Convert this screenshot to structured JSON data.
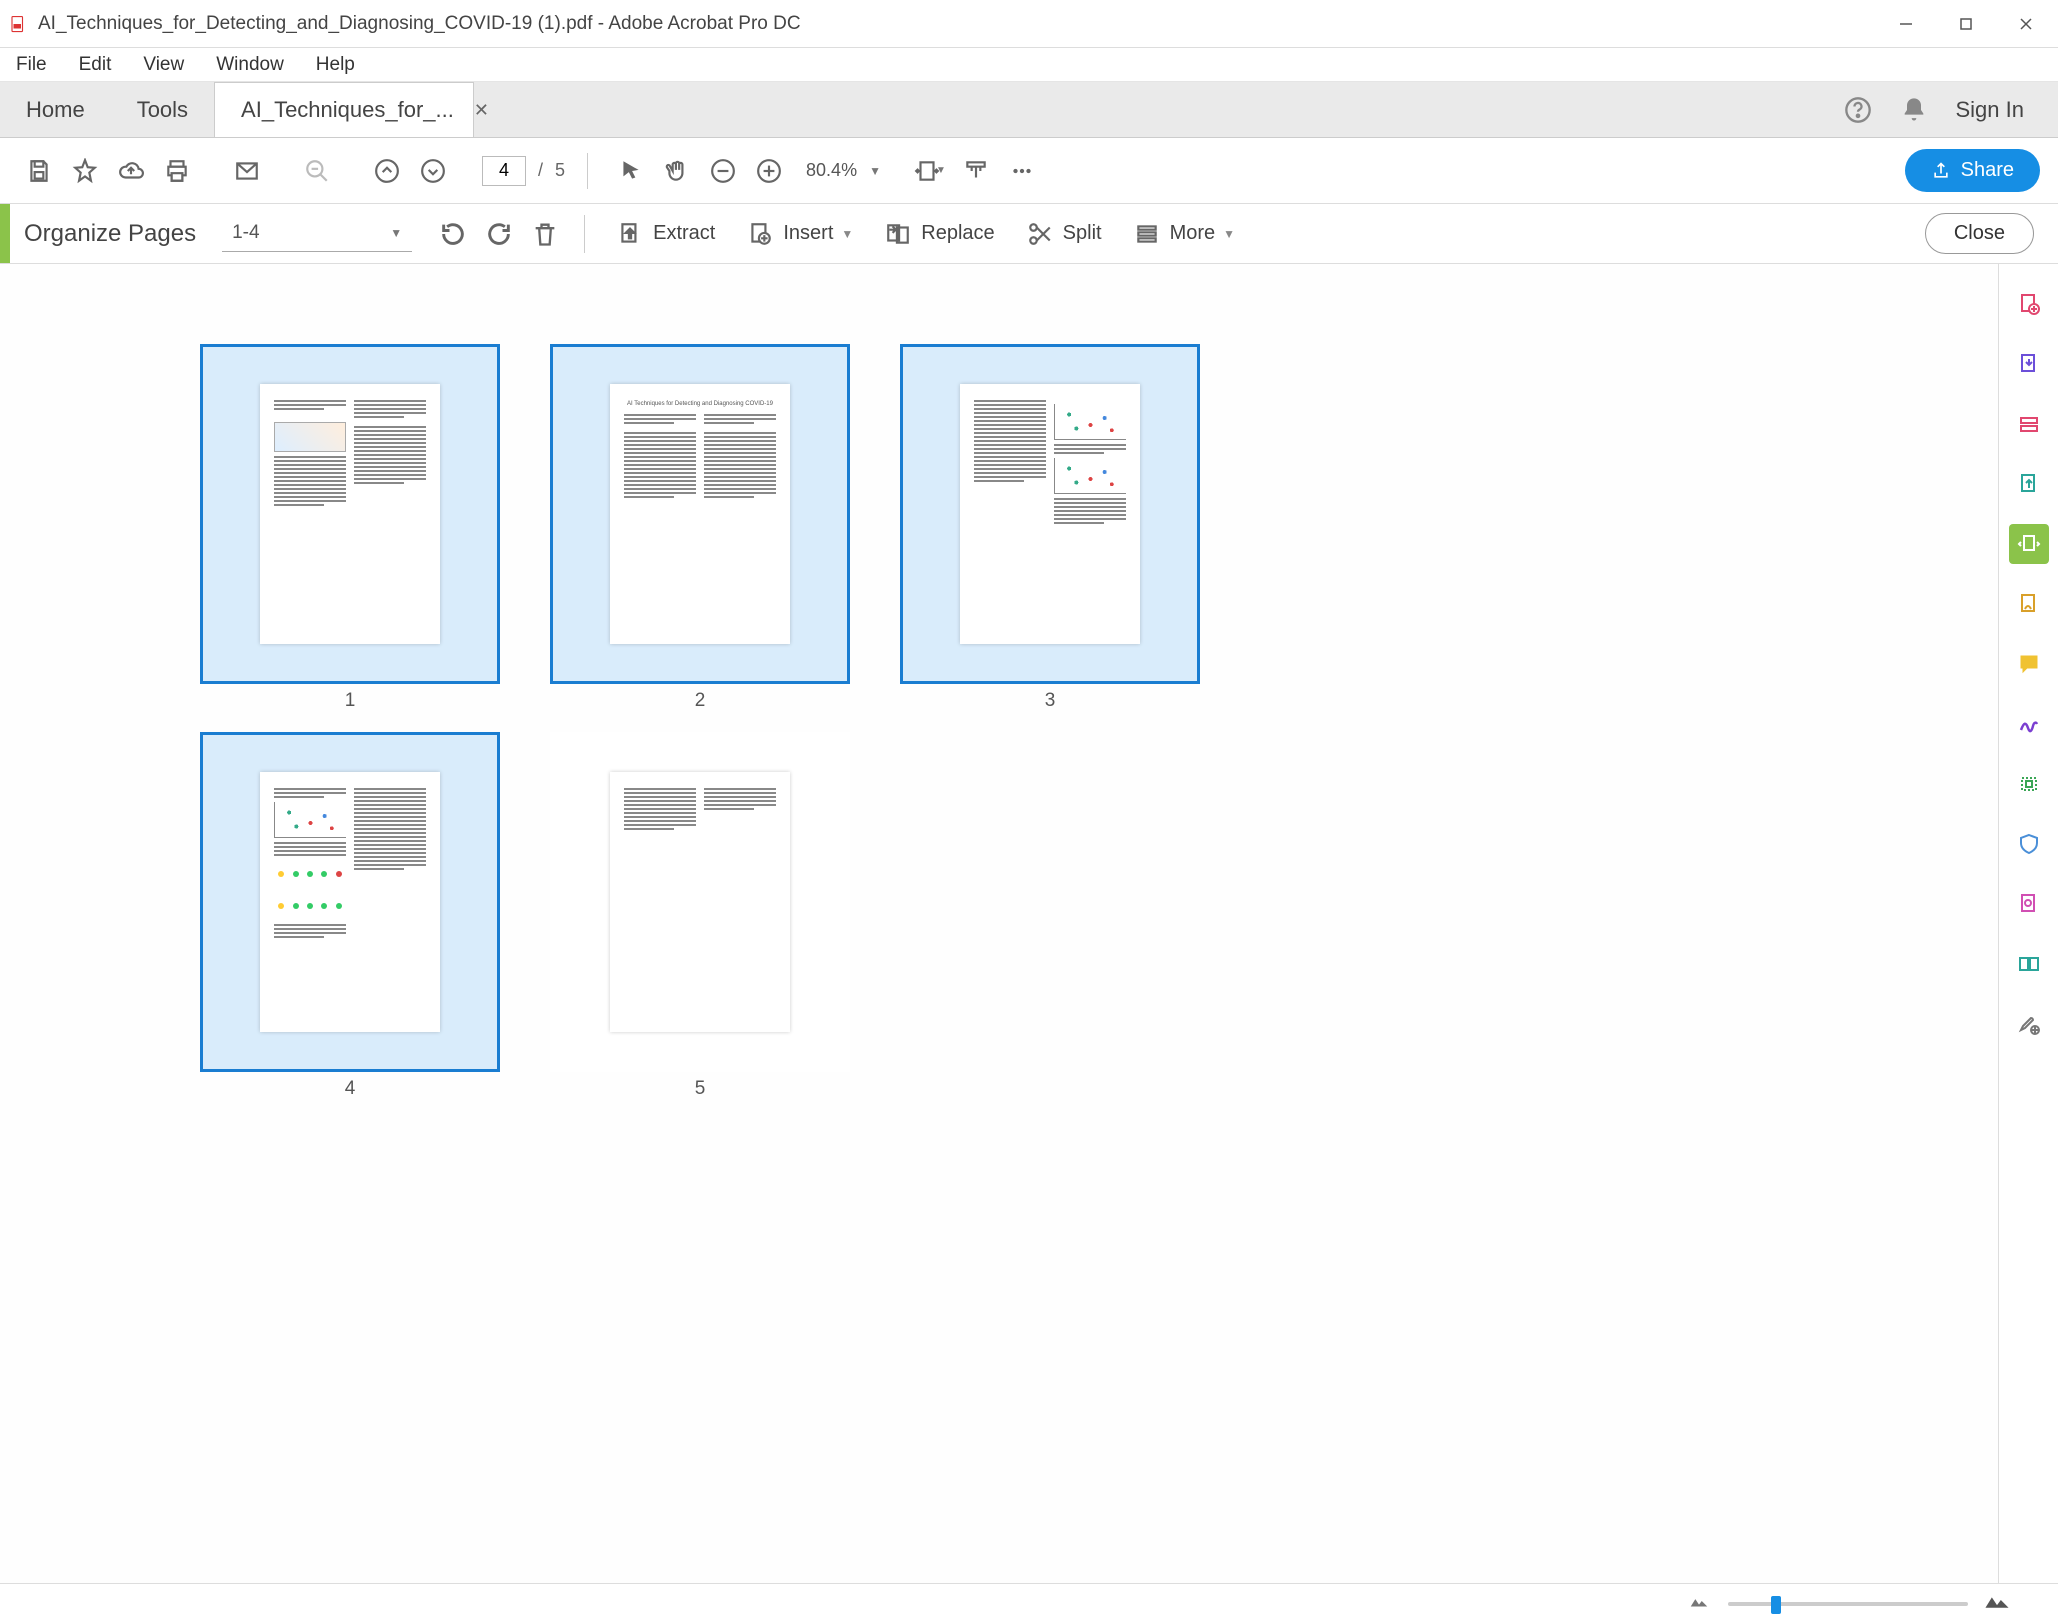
{
  "window": {
    "title": "AI_Techniques_for_Detecting_and_Diagnosing_COVID-19 (1).pdf - Adobe Acrobat Pro DC"
  },
  "menu": {
    "items": [
      "File",
      "Edit",
      "View",
      "Window",
      "Help"
    ]
  },
  "tabs": {
    "home": "Home",
    "tools": "Tools",
    "doc": "AI_Techniques_for_...",
    "signin": "Sign In"
  },
  "toolbar": {
    "current_page": "4",
    "page_sep": "/",
    "total_pages": "5",
    "zoom": "80.4%",
    "share": "Share"
  },
  "organize": {
    "title": "Organize Pages",
    "range": "1-4",
    "extract": "Extract",
    "insert": "Insert",
    "replace": "Replace",
    "split": "Split",
    "more": "More",
    "close": "Close"
  },
  "pages": {
    "labels": [
      "1",
      "2",
      "3",
      "4",
      "5"
    ],
    "paper_title": "AI Techniques for Detecting and Diagnosing COVID-19"
  }
}
